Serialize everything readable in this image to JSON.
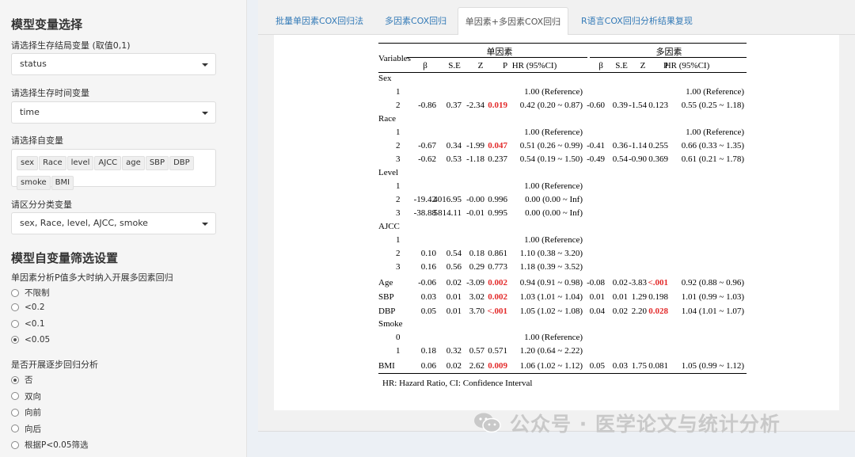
{
  "sidebar": {
    "model_title": "模型变量选择",
    "outcome_label": "请选择生存结局变量 (取值0,1)",
    "outcome_value": "status",
    "time_label": "请选择生存时间变量",
    "time_value": "time",
    "indep_label": "请选择自变量",
    "indep_chips": [
      "sex",
      "Race",
      "level",
      "AJCC",
      "age",
      "SBP",
      "DBP",
      "smoke",
      "BMI"
    ],
    "cat_label": "请区分分类变量",
    "cat_value": "sex, Race, level, AJCC, smoke",
    "screen_title": "模型自变量筛选设置",
    "p_label": "单因素分析P值多大时纳入开展多因素回归",
    "p_options": [
      "不限制",
      "<0.2",
      "<0.1",
      "<0.05"
    ],
    "p_selected": 3,
    "step_label": "是否开展逐步回归分析",
    "step_options": [
      "否",
      "双向",
      "向前",
      "向后",
      "根据P<0.05筛选"
    ],
    "step_selected": 0
  },
  "tabs": [
    "批量单因素COX回归法",
    "多因素COX回归",
    "单因素+多因素COX回归",
    "R语言COX回归分析结果复现"
  ],
  "active_tab": 2,
  "table": {
    "group_uni": "单因素",
    "group_multi": "多因素",
    "var_header": "Variables",
    "uni_headers": [
      "β",
      "S.E",
      "Z",
      "P",
      "HR (95%CI)"
    ],
    "multi_headers": [
      "β",
      "S.E",
      "Z",
      "P",
      "HR (95%CI)"
    ],
    "rows": [
      {
        "label": "Sex",
        "indent": false,
        "uni": [
          "",
          "",
          "",
          "",
          ""
        ],
        "multi": [
          "",
          "",
          "",
          "",
          ""
        ],
        "uni_sig": false,
        "multi_sig": false
      },
      {
        "label": "1",
        "indent": true,
        "uni": [
          "",
          "",
          "",
          "",
          "1.00 (Reference)"
        ],
        "multi": [
          "",
          "",
          "",
          "",
          "1.00 (Reference)"
        ],
        "uni_sig": false,
        "multi_sig": false
      },
      {
        "label": "2",
        "indent": true,
        "uni": [
          "-0.86",
          "0.37",
          "-2.34",
          "0.019",
          "0.42 (0.20 ~ 0.87)"
        ],
        "multi": [
          "-0.60",
          "0.39",
          "-1.54",
          "0.123",
          "0.55 (0.25 ~ 1.18)"
        ],
        "uni_sig": true,
        "multi_sig": false
      },
      {
        "label": "Race",
        "indent": false,
        "uni": [
          "",
          "",
          "",
          "",
          ""
        ],
        "multi": [
          "",
          "",
          "",
          "",
          ""
        ],
        "uni_sig": false,
        "multi_sig": false
      },
      {
        "label": "1",
        "indent": true,
        "uni": [
          "",
          "",
          "",
          "",
          "1.00 (Reference)"
        ],
        "multi": [
          "",
          "",
          "",
          "",
          "1.00 (Reference)"
        ],
        "uni_sig": false,
        "multi_sig": false
      },
      {
        "label": "2",
        "indent": true,
        "uni": [
          "-0.67",
          "0.34",
          "-1.99",
          "0.047",
          "0.51 (0.26 ~ 0.99)"
        ],
        "multi": [
          "-0.41",
          "0.36",
          "-1.14",
          "0.255",
          "0.66 (0.33 ~ 1.35)"
        ],
        "uni_sig": true,
        "multi_sig": false
      },
      {
        "label": "3",
        "indent": true,
        "uni": [
          "-0.62",
          "0.53",
          "-1.18",
          "0.237",
          "0.54 (0.19 ~ 1.50)"
        ],
        "multi": [
          "-0.49",
          "0.54",
          "-0.90",
          "0.369",
          "0.61 (0.21 ~ 1.78)"
        ],
        "uni_sig": false,
        "multi_sig": false
      },
      {
        "label": "Level",
        "indent": false,
        "uni": [
          "",
          "",
          "",
          "",
          ""
        ],
        "multi": [
          "",
          "",
          "",
          "",
          ""
        ],
        "uni_sig": false,
        "multi_sig": false
      },
      {
        "label": "1",
        "indent": true,
        "uni": [
          "",
          "",
          "",
          "",
          "1.00 (Reference)"
        ],
        "multi": [
          "",
          "",
          "",
          "",
          ""
        ],
        "uni_sig": false,
        "multi_sig": false
      },
      {
        "label": "2",
        "indent": true,
        "uni": [
          "-19.42",
          "4016.95",
          "-0.00",
          "0.996",
          "0.00 (0.00 ~ Inf)"
        ],
        "multi": [
          "",
          "",
          "",
          "",
          ""
        ],
        "uni_sig": false,
        "multi_sig": false
      },
      {
        "label": "3",
        "indent": true,
        "uni": [
          "-38.88",
          "5814.11",
          "-0.01",
          "0.995",
          "0.00 (0.00 ~ Inf)"
        ],
        "multi": [
          "",
          "",
          "",
          "",
          ""
        ],
        "uni_sig": false,
        "multi_sig": false
      },
      {
        "label": "AJCC",
        "indent": false,
        "uni": [
          "",
          "",
          "",
          "",
          ""
        ],
        "multi": [
          "",
          "",
          "",
          "",
          ""
        ],
        "uni_sig": false,
        "multi_sig": false
      },
      {
        "label": "1",
        "indent": true,
        "uni": [
          "",
          "",
          "",
          "",
          "1.00 (Reference)"
        ],
        "multi": [
          "",
          "",
          "",
          "",
          ""
        ],
        "uni_sig": false,
        "multi_sig": false
      },
      {
        "label": "2",
        "indent": true,
        "uni": [
          "0.10",
          "0.54",
          "0.18",
          "0.861",
          "1.10 (0.38 ~ 3.20)"
        ],
        "multi": [
          "",
          "",
          "",
          "",
          ""
        ],
        "uni_sig": false,
        "multi_sig": false
      },
      {
        "label": "3",
        "indent": true,
        "uni": [
          "0.16",
          "0.56",
          "0.29",
          "0.773",
          "1.18 (0.39 ~ 3.52)"
        ],
        "multi": [
          "",
          "",
          "",
          "",
          ""
        ],
        "uni_sig": false,
        "multi_sig": false
      },
      {
        "label": "Age",
        "indent": false,
        "uni": [
          "-0.06",
          "0.02",
          "-3.09",
          "0.002",
          "0.94 (0.91 ~ 0.98)"
        ],
        "multi": [
          "-0.08",
          "0.02",
          "-3.83",
          "<.001",
          "0.92 (0.88 ~ 0.96)"
        ],
        "uni_sig": true,
        "multi_sig": true
      },
      {
        "label": "SBP",
        "indent": false,
        "uni": [
          "0.03",
          "0.01",
          "3.02",
          "0.002",
          "1.03 (1.01 ~ 1.04)"
        ],
        "multi": [
          "0.01",
          "0.01",
          "1.29",
          "0.198",
          "1.01 (0.99 ~ 1.03)"
        ],
        "uni_sig": true,
        "multi_sig": false
      },
      {
        "label": "DBP",
        "indent": false,
        "uni": [
          "0.05",
          "0.01",
          "3.70",
          "<.001",
          "1.05 (1.02 ~ 1.08)"
        ],
        "multi": [
          "0.04",
          "0.02",
          "2.20",
          "0.028",
          "1.04 (1.01 ~ 1.07)"
        ],
        "uni_sig": true,
        "multi_sig": true
      },
      {
        "label": "Smoke",
        "indent": false,
        "uni": [
          "",
          "",
          "",
          "",
          ""
        ],
        "multi": [
          "",
          "",
          "",
          "",
          ""
        ],
        "uni_sig": false,
        "multi_sig": false
      },
      {
        "label": "0",
        "indent": true,
        "uni": [
          "",
          "",
          "",
          "",
          "1.00 (Reference)"
        ],
        "multi": [
          "",
          "",
          "",
          "",
          ""
        ],
        "uni_sig": false,
        "multi_sig": false
      },
      {
        "label": "1",
        "indent": true,
        "uni": [
          "0.18",
          "0.32",
          "0.57",
          "0.571",
          "1.20 (0.64 ~ 2.22)"
        ],
        "multi": [
          "",
          "",
          "",
          "",
          ""
        ],
        "uni_sig": false,
        "multi_sig": false
      },
      {
        "label": "BMI",
        "indent": false,
        "uni": [
          "0.06",
          "0.02",
          "2.62",
          "0.009",
          "1.06 (1.02 ~ 1.12)"
        ],
        "multi": [
          "0.05",
          "0.03",
          "1.75",
          "0.081",
          "1.05 (0.99 ~ 1.12)"
        ],
        "uni_sig": true,
        "multi_sig": false
      }
    ],
    "footnote": "HR: Hazard Ratio, CI: Confidence Interval"
  },
  "watermark": "公众号 · 医学论文与统计分析",
  "colors": {
    "significant": "#e32b2b",
    "link": "#337ab7"
  }
}
